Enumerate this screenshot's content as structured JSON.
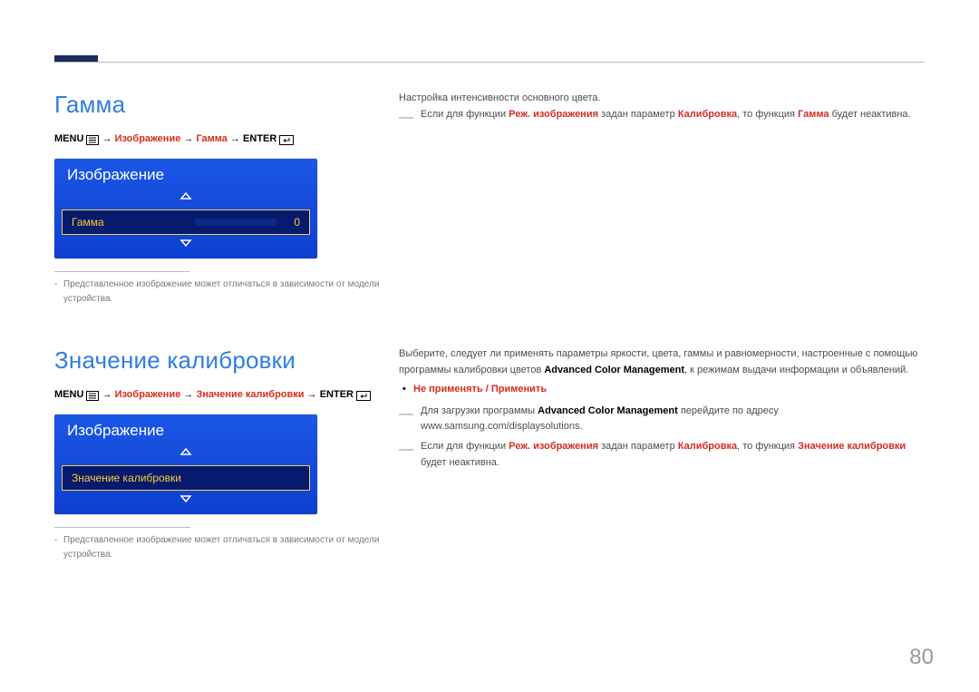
{
  "page": {
    "number": "80"
  },
  "gamma": {
    "title": "Гамма",
    "menuPath": {
      "menu": "MENU",
      "arrow": "→",
      "item1": "Изображение",
      "item2": "Гамма",
      "enter": "ENTER"
    },
    "osd": {
      "header": "Изображение",
      "itemLabel": "Гамма",
      "value": "0"
    },
    "caption": "Представленное изображение может отличаться в зависимости от модели устройства.",
    "desc": {
      "line1": "Настройка интенсивности основного цвета.",
      "note": {
        "pre": "Если для функции ",
        "mode": "Реж. изображения",
        "mid": " задан параметр ",
        "calib": "Калибровка",
        "post1": ", то функция ",
        "gamma": "Гамма",
        "post2": " будет неактивна."
      }
    }
  },
  "calibration": {
    "title": "Значение калибровки",
    "menuPath": {
      "menu": "MENU",
      "arrow": "→",
      "item1": "Изображение",
      "item2": "Значение калибровки",
      "enter": "ENTER"
    },
    "osd": {
      "header": "Изображение",
      "itemLabel": "Значение калибровки"
    },
    "caption": "Представленное изображение может отличаться в зависимости от модели устройства.",
    "desc": {
      "para": "Выберите, следует ли применять параметры яркости, цвета, гаммы и равномерности, настроенные с помощью программы калибровки цветов ",
      "acm": "Advanced Color Management",
      "paraCont": ", к режимам выдачи информации и объявлений.",
      "options": "Не применять / Применить",
      "dlNote": {
        "pre": "Для загрузки программы ",
        "acm": "Advanced Color Management",
        "mid": " перейдите по адресу ",
        "url": "www.samsung.com/displaysolutions."
      },
      "inactiveNote": {
        "pre": "Если для функции ",
        "mode": "Реж. изображения",
        "mid": " задан параметр ",
        "calib": "Калибровка",
        "post1": ", то функция ",
        "cv": "Значение калибровки",
        "post2": " будет неактивна."
      }
    }
  }
}
